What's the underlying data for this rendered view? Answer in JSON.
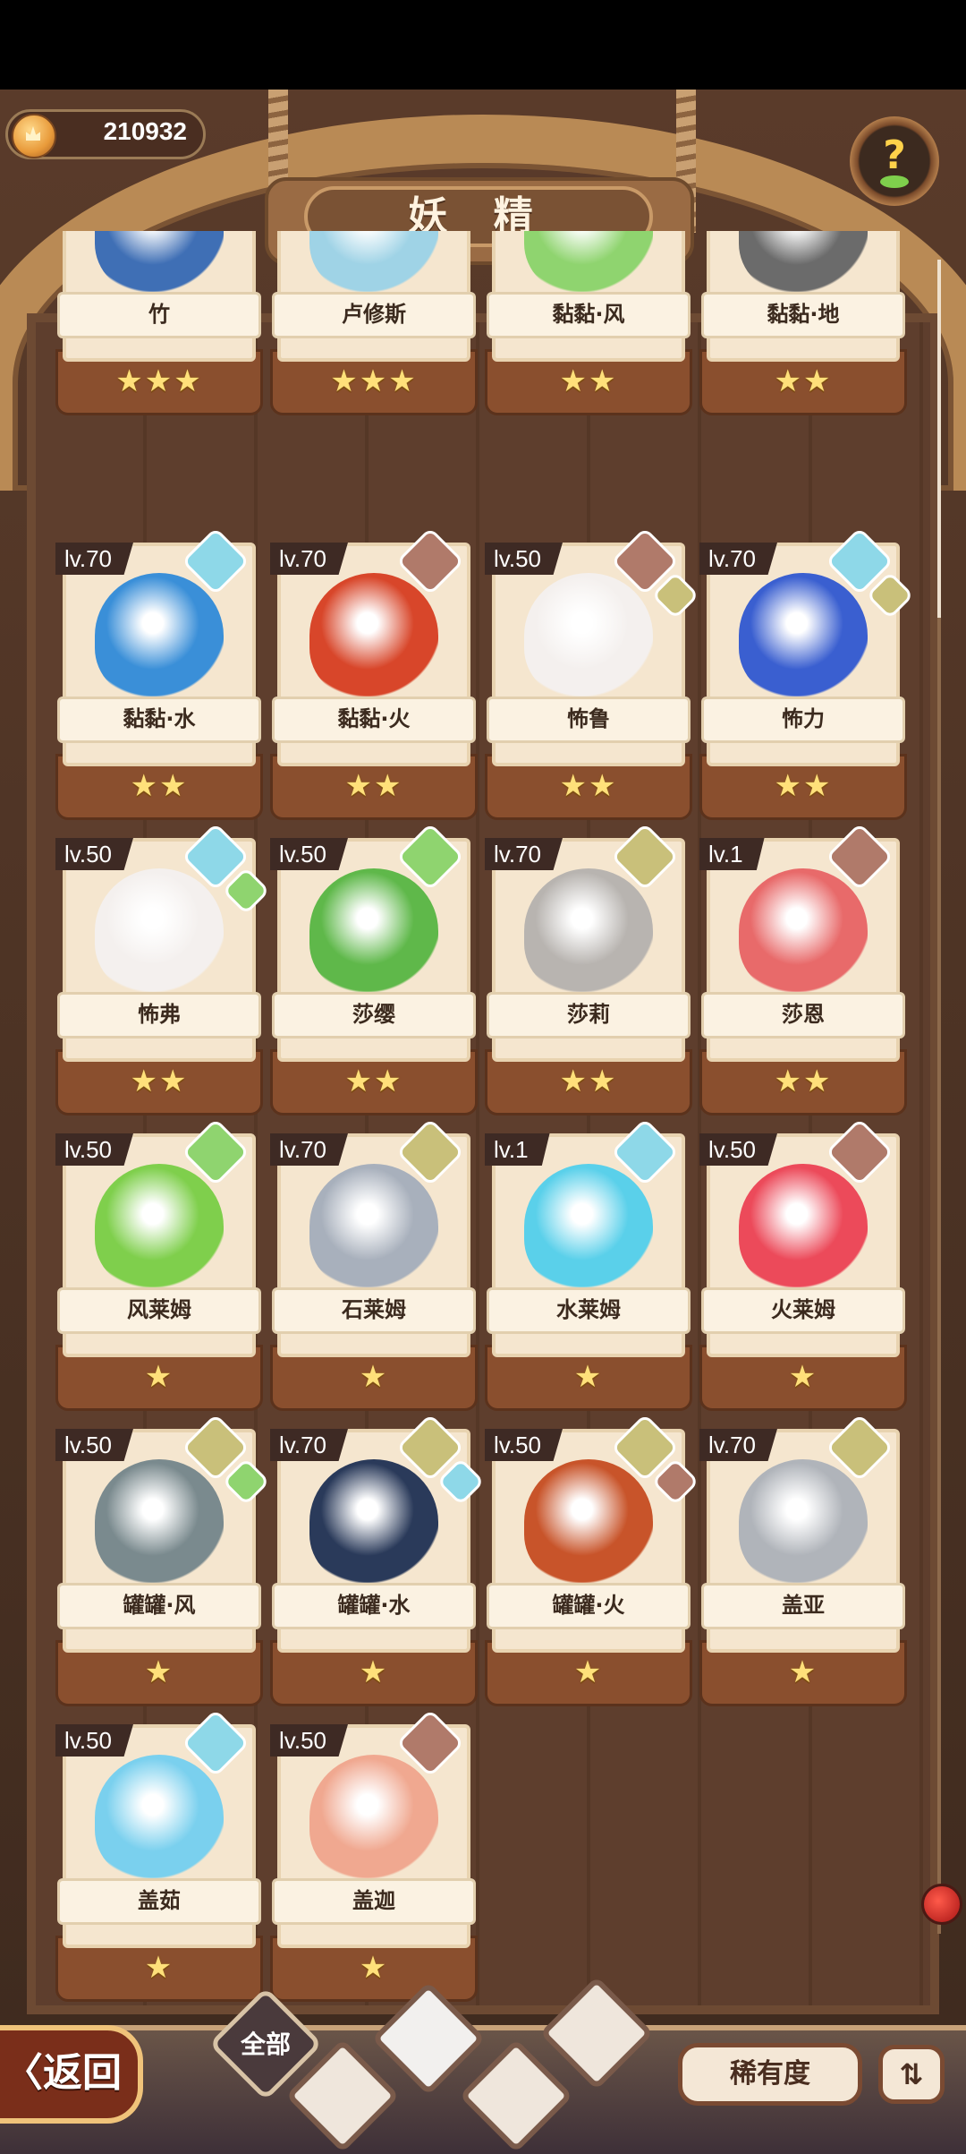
{
  "header": {
    "coins": "210932",
    "title": "妖 精",
    "help_icon": "question-leaf-icon"
  },
  "cards": [
    {
      "name": "竹",
      "stars": 3,
      "level": "",
      "elements": [],
      "color": "#3f6fb5"
    },
    {
      "name": "卢修斯",
      "stars": 3,
      "level": "",
      "elements": [],
      "color": "#9fd3e6"
    },
    {
      "name": "黏黏·风",
      "stars": 2,
      "level": "",
      "elements": [],
      "color": "#8fd46f"
    },
    {
      "name": "黏黏·地",
      "stars": 2,
      "level": "",
      "elements": [],
      "color": "#6b6b6b"
    },
    {
      "name": "黏黏·水",
      "stars": 2,
      "level": "lv.70",
      "elements": [
        "water"
      ],
      "color": "#3a8fd8"
    },
    {
      "name": "黏黏·火",
      "stars": 2,
      "level": "lv.70",
      "elements": [
        "fire"
      ],
      "color": "#d8462a"
    },
    {
      "name": "怖鲁",
      "stars": 2,
      "level": "lv.50",
      "elements": [
        "fire",
        "earth"
      ],
      "color": "#f4f0ee"
    },
    {
      "name": "怖力",
      "stars": 2,
      "level": "lv.70",
      "elements": [
        "water",
        "earth"
      ],
      "color": "#3a5fd0"
    },
    {
      "name": "怖弗",
      "stars": 2,
      "level": "lv.50",
      "elements": [
        "water",
        "wind"
      ],
      "color": "#f4f0ee"
    },
    {
      "name": "莎缨",
      "stars": 2,
      "level": "lv.50",
      "elements": [
        "wind"
      ],
      "color": "#5fb84a"
    },
    {
      "name": "莎莉",
      "stars": 2,
      "level": "lv.70",
      "elements": [
        "earth"
      ],
      "color": "#b8b4b0"
    },
    {
      "name": "莎恩",
      "stars": 2,
      "level": "lv.1",
      "elements": [
        "fire"
      ],
      "color": "#e86a6a"
    },
    {
      "name": "风莱姆",
      "stars": 1,
      "level": "lv.50",
      "elements": [
        "wind"
      ],
      "color": "#7fcf4c"
    },
    {
      "name": "石莱姆",
      "stars": 1,
      "level": "lv.70",
      "elements": [
        "earth"
      ],
      "color": "#a8b0bc"
    },
    {
      "name": "水莱姆",
      "stars": 1,
      "level": "lv.1",
      "elements": [
        "water"
      ],
      "color": "#5ad0ea"
    },
    {
      "name": "火莱姆",
      "stars": 1,
      "level": "lv.50",
      "elements": [
        "fire"
      ],
      "color": "#ec4a5a"
    },
    {
      "name": "罐罐·风",
      "stars": 1,
      "level": "lv.50",
      "elements": [
        "earth",
        "wind"
      ],
      "color": "#7a8a8e"
    },
    {
      "name": "罐罐·水",
      "stars": 1,
      "level": "lv.70",
      "elements": [
        "earth",
        "water"
      ],
      "color": "#2a3a5a"
    },
    {
      "name": "罐罐·火",
      "stars": 1,
      "level": "lv.50",
      "elements": [
        "earth",
        "fire"
      ],
      "color": "#c8542a"
    },
    {
      "name": "盖亚",
      "stars": 1,
      "level": "lv.70",
      "elements": [
        "earth"
      ],
      "color": "#b0b4ba"
    },
    {
      "name": "盖茹",
      "stars": 1,
      "level": "lv.50",
      "elements": [
        "water"
      ],
      "color": "#7ad0ee"
    },
    {
      "name": "盖迦",
      "stars": 1,
      "level": "lv.50",
      "elements": [
        "fire"
      ],
      "color": "#f0a890"
    }
  ],
  "bottom": {
    "back_label": "〈返回",
    "filter_all": "全部",
    "rarity_label": "稀有度",
    "sort_icon": "sort-list-icon",
    "filters": [
      "water-filter",
      "wind-filter",
      "earth-filter",
      "mountain-filter"
    ]
  }
}
